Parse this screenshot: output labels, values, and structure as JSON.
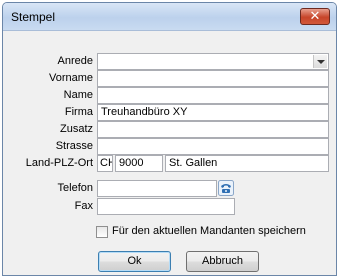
{
  "window": {
    "title": "Stempel",
    "close_glyph": "✕"
  },
  "form": {
    "anrede": {
      "label": "Anrede",
      "value": ""
    },
    "vorname": {
      "label": "Vorname",
      "value": ""
    },
    "name": {
      "label": "Name",
      "value": ""
    },
    "firma": {
      "label": "Firma",
      "value": "Treuhandbüro XY"
    },
    "zusatz": {
      "label": "Zusatz",
      "value": ""
    },
    "strasse": {
      "label": "Strasse",
      "value": ""
    },
    "land_plz_ort": {
      "label": "Land-PLZ-Ort",
      "land": "CH",
      "plz": "9000",
      "ort": "St. Gallen"
    },
    "telefon": {
      "label": "Telefon",
      "value": ""
    },
    "fax": {
      "label": "Fax",
      "value": ""
    }
  },
  "checkbox": {
    "label": "Für den aktuellen Mandanten speichern",
    "checked": false
  },
  "buttons": {
    "ok": "Ok",
    "cancel": "Abbruch"
  },
  "icons": {
    "close": "close-icon",
    "dropdown": "chevron-down-icon",
    "phone": "phone-icon"
  },
  "colors": {
    "titlebar": "#c9dbf1",
    "close_button": "#c7452a",
    "dialog_bg": "#f0f0f0",
    "input_border": "#abadb3",
    "default_button_border": "#3c7fb1"
  }
}
